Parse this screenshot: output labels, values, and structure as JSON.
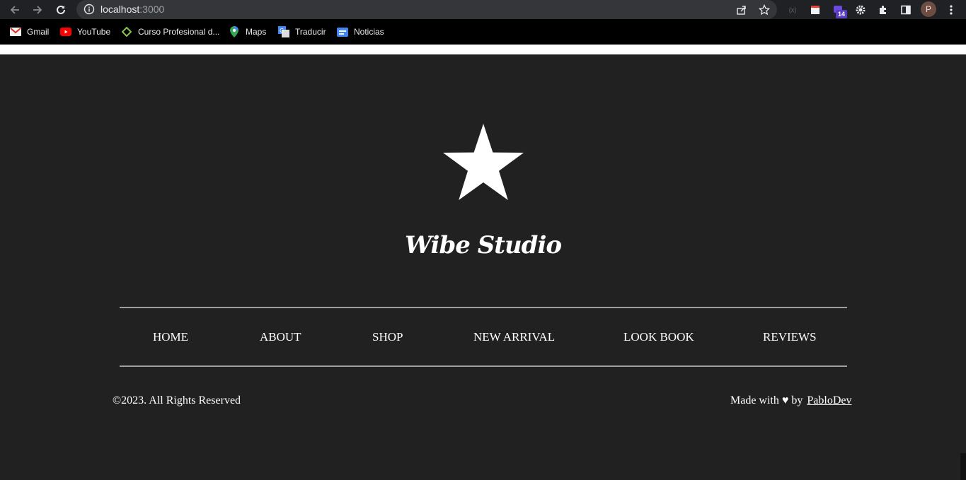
{
  "browser": {
    "url_host": "localhost",
    "url_port": ":3000",
    "extension_badge": "14",
    "profile_initial": "P"
  },
  "bookmarks": [
    {
      "label": "Gmail",
      "icon": "gmail-icon"
    },
    {
      "label": "YouTube",
      "icon": "youtube-icon"
    },
    {
      "label": "Curso Profesional d...",
      "icon": "course-icon"
    },
    {
      "label": "Maps",
      "icon": "maps-icon"
    },
    {
      "label": "Traducir",
      "icon": "translate-icon"
    },
    {
      "label": "Noticias",
      "icon": "news-icon"
    }
  ],
  "footer": {
    "brand": "Wibe Studio",
    "logo_icon": "star-icon",
    "menu": [
      "HOME",
      "ABOUT",
      "SHOP",
      "NEW ARRIVAL",
      "LOOK BOOK",
      "REVIEWS"
    ],
    "copyright": "©2023. All Rights Reserved",
    "made_with": "Made with ♥ by",
    "author_link": "PabloDev"
  },
  "colors": {
    "footer_bg": "#212121",
    "text": "#ffffff",
    "rule": "#9e9e9e",
    "chrome_bg": "#202124",
    "omnibox_bg": "#35363a"
  }
}
